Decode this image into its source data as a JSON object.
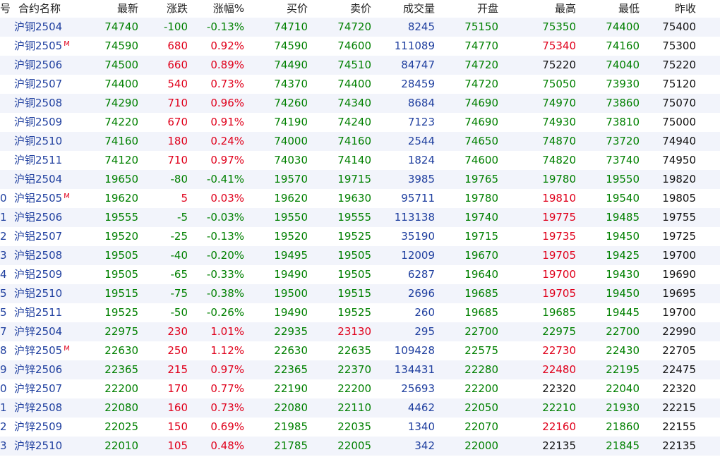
{
  "headers": {
    "idx": "号",
    "name": "合约名称",
    "last": "最新",
    "change": "涨跌",
    "change_pct": "涨幅%",
    "bid": "买价",
    "ask": "卖价",
    "volume": "成交量",
    "open": "开盘",
    "high": "最高",
    "low": "最低",
    "prev_close": "昨收"
  },
  "colors": {
    "up": "#e0001b",
    "down": "#008000",
    "flat": "#111111",
    "volume": "#1f3f9f",
    "stripe": "#f2f4fb"
  },
  "rows": [
    {
      "idx": "",
      "name": "沪铜2504",
      "mark": "",
      "last": "74740",
      "change": "-100",
      "change_pct": "-0.13%",
      "bid": "74710",
      "ask": "74720",
      "volume": "8245",
      "open": "75150",
      "high": "75350",
      "low": "74400",
      "prev_close": "75400"
    },
    {
      "idx": "",
      "name": "沪铜2505",
      "mark": "M",
      "last": "74590",
      "change": "680",
      "change_pct": "0.92%",
      "bid": "74590",
      "ask": "74600",
      "volume": "111089",
      "open": "74770",
      "high": "75340",
      "low": "74160",
      "prev_close": "75300"
    },
    {
      "idx": "",
      "name": "沪铜2506",
      "mark": "",
      "last": "74500",
      "change": "660",
      "change_pct": "0.89%",
      "bid": "74490",
      "ask": "74510",
      "volume": "84747",
      "open": "74720",
      "high": "75220",
      "low": "74040",
      "prev_close": "75220"
    },
    {
      "idx": "",
      "name": "沪铜2507",
      "mark": "",
      "last": "74400",
      "change": "540",
      "change_pct": "0.73%",
      "bid": "74370",
      "ask": "74400",
      "volume": "28459",
      "open": "74720",
      "high": "75050",
      "low": "73930",
      "prev_close": "75120"
    },
    {
      "idx": "",
      "name": "沪铜2508",
      "mark": "",
      "last": "74290",
      "change": "710",
      "change_pct": "0.96%",
      "bid": "74260",
      "ask": "74340",
      "volume": "8684",
      "open": "74690",
      "high": "74970",
      "low": "73860",
      "prev_close": "75070"
    },
    {
      "idx": "",
      "name": "沪铜2509",
      "mark": "",
      "last": "74220",
      "change": "670",
      "change_pct": "0.91%",
      "bid": "74190",
      "ask": "74240",
      "volume": "7123",
      "open": "74690",
      "high": "74930",
      "low": "73810",
      "prev_close": "75000"
    },
    {
      "idx": "",
      "name": "沪铜2510",
      "mark": "",
      "last": "74160",
      "change": "180",
      "change_pct": "0.24%",
      "bid": "74000",
      "ask": "74160",
      "volume": "2544",
      "open": "74650",
      "high": "74870",
      "low": "73720",
      "prev_close": "74940"
    },
    {
      "idx": "",
      "name": "沪铜2511",
      "mark": "",
      "last": "74120",
      "change": "710",
      "change_pct": "0.97%",
      "bid": "74030",
      "ask": "74140",
      "volume": "1824",
      "open": "74600",
      "high": "74820",
      "low": "73740",
      "prev_close": "74950"
    },
    {
      "idx": "",
      "name": "沪铝2504",
      "mark": "",
      "last": "19650",
      "change": "-80",
      "change_pct": "-0.41%",
      "bid": "19570",
      "ask": "19715",
      "volume": "3985",
      "open": "19765",
      "high": "19780",
      "low": "19550",
      "prev_close": "19820"
    },
    {
      "idx": "0",
      "name": "沪铝2505",
      "mark": "M",
      "last": "19620",
      "change": "5",
      "change_pct": "0.03%",
      "bid": "19620",
      "ask": "19630",
      "volume": "95711",
      "open": "19780",
      "high": "19810",
      "low": "19540",
      "prev_close": "19805"
    },
    {
      "idx": "1",
      "name": "沪铝2506",
      "mark": "",
      "last": "19555",
      "change": "-5",
      "change_pct": "-0.03%",
      "bid": "19550",
      "ask": "19555",
      "volume": "113138",
      "open": "19740",
      "high": "19775",
      "low": "19485",
      "prev_close": "19755"
    },
    {
      "idx": "2",
      "name": "沪铝2507",
      "mark": "",
      "last": "19520",
      "change": "-25",
      "change_pct": "-0.13%",
      "bid": "19520",
      "ask": "19525",
      "volume": "35190",
      "open": "19715",
      "high": "19735",
      "low": "19450",
      "prev_close": "19725"
    },
    {
      "idx": "3",
      "name": "沪铝2508",
      "mark": "",
      "last": "19505",
      "change": "-40",
      "change_pct": "-0.20%",
      "bid": "19495",
      "ask": "19505",
      "volume": "12009",
      "open": "19670",
      "high": "19705",
      "low": "19425",
      "prev_close": "19700"
    },
    {
      "idx": "4",
      "name": "沪铝2509",
      "mark": "",
      "last": "19505",
      "change": "-65",
      "change_pct": "-0.33%",
      "bid": "19490",
      "ask": "19505",
      "volume": "6287",
      "open": "19640",
      "high": "19700",
      "low": "19430",
      "prev_close": "19690"
    },
    {
      "idx": "5",
      "name": "沪铝2510",
      "mark": "",
      "last": "19515",
      "change": "-75",
      "change_pct": "-0.38%",
      "bid": "19500",
      "ask": "19515",
      "volume": "2696",
      "open": "19685",
      "high": "19705",
      "low": "19450",
      "prev_close": "19695"
    },
    {
      "idx": "5",
      "name": "沪铝2511",
      "mark": "",
      "last": "19525",
      "change": "-50",
      "change_pct": "-0.26%",
      "bid": "19490",
      "ask": "19525",
      "volume": "260",
      "open": "19685",
      "high": "19685",
      "low": "19445",
      "prev_close": "19700"
    },
    {
      "idx": "7",
      "name": "沪锌2504",
      "mark": "",
      "last": "22975",
      "change": "230",
      "change_pct": "1.01%",
      "bid": "22935",
      "ask": "23130",
      "volume": "295",
      "open": "22700",
      "high": "22975",
      "low": "22700",
      "prev_close": "22990"
    },
    {
      "idx": "8",
      "name": "沪锌2505",
      "mark": "M",
      "last": "22630",
      "change": "250",
      "change_pct": "1.12%",
      "bid": "22630",
      "ask": "22635",
      "volume": "109428",
      "open": "22575",
      "high": "22730",
      "low": "22430",
      "prev_close": "22705"
    },
    {
      "idx": "9",
      "name": "沪锌2506",
      "mark": "",
      "last": "22365",
      "change": "215",
      "change_pct": "0.97%",
      "bid": "22365",
      "ask": "22370",
      "volume": "134431",
      "open": "22280",
      "high": "22480",
      "low": "22195",
      "prev_close": "22475"
    },
    {
      "idx": "0",
      "name": "沪锌2507",
      "mark": "",
      "last": "22200",
      "change": "170",
      "change_pct": "0.77%",
      "bid": "22190",
      "ask": "22200",
      "volume": "25693",
      "open": "22200",
      "high": "22320",
      "low": "22040",
      "prev_close": "22320"
    },
    {
      "idx": "1",
      "name": "沪锌2508",
      "mark": "",
      "last": "22080",
      "change": "160",
      "change_pct": "0.73%",
      "bid": "22080",
      "ask": "22110",
      "volume": "4462",
      "open": "22050",
      "high": "22210",
      "low": "21930",
      "prev_close": "22215"
    },
    {
      "idx": "2",
      "name": "沪锌2509",
      "mark": "",
      "last": "22025",
      "change": "150",
      "change_pct": "0.69%",
      "bid": "21985",
      "ask": "22035",
      "volume": "1340",
      "open": "22070",
      "high": "22160",
      "low": "21860",
      "prev_close": "22155"
    },
    {
      "idx": "3",
      "name": "沪锌2510",
      "mark": "",
      "last": "22010",
      "change": "105",
      "change_pct": "0.48%",
      "bid": "21785",
      "ask": "22005",
      "volume": "342",
      "open": "22000",
      "high": "22135",
      "low": "21845",
      "prev_close": "22135"
    }
  ]
}
